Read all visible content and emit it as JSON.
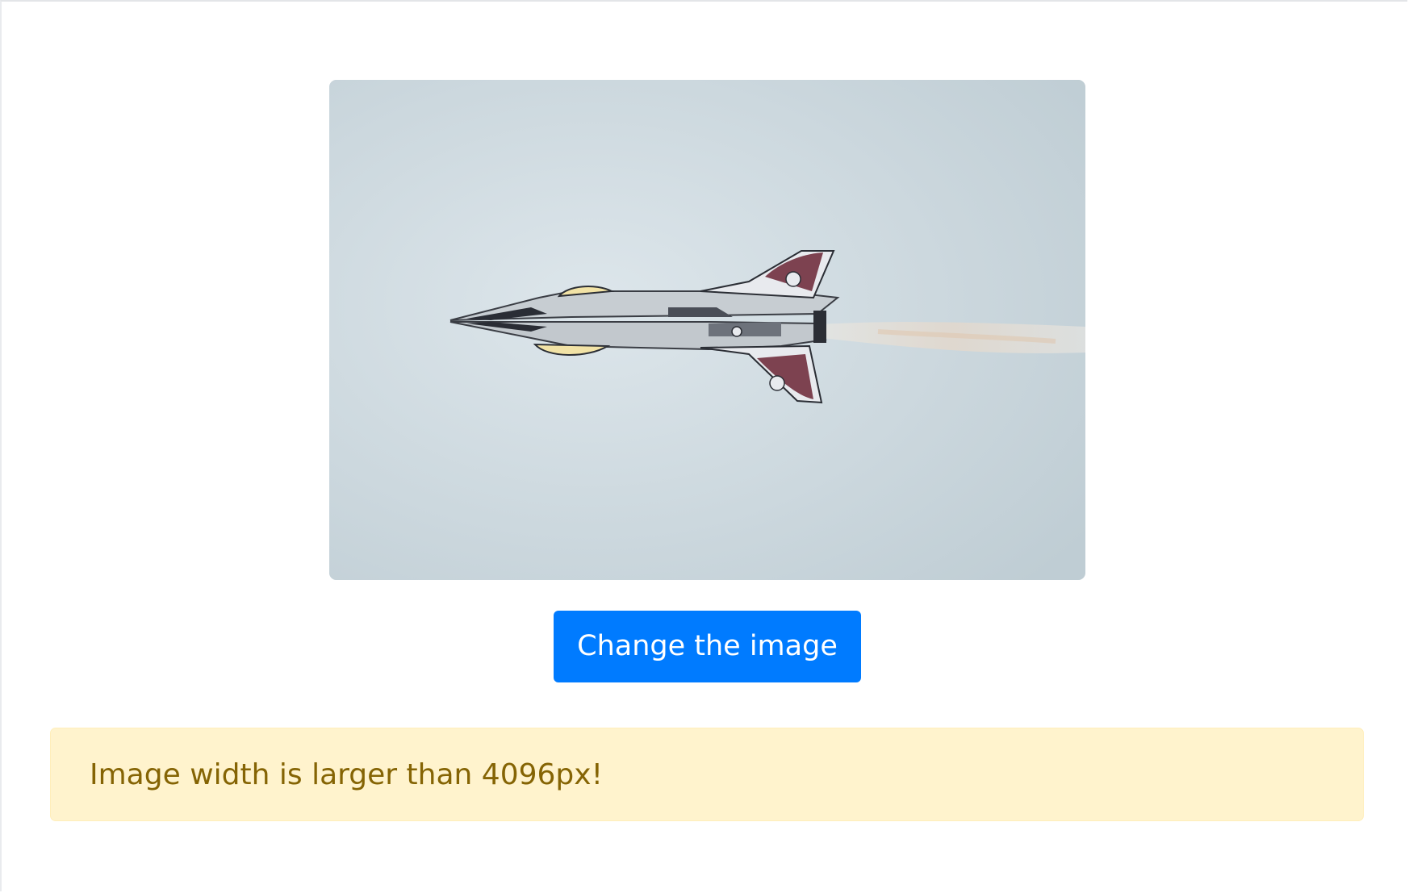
{
  "preview": {
    "image_description_icon": "jet-aircraft-photo",
    "sky_color": "#d3dee3"
  },
  "actions": {
    "change_image_label": "Change the image"
  },
  "alert": {
    "message": "Image width is larger than 4096px!",
    "type": "warning",
    "background": "#fff3cd",
    "text_color": "#856404"
  },
  "colors": {
    "primary": "#007bff"
  }
}
